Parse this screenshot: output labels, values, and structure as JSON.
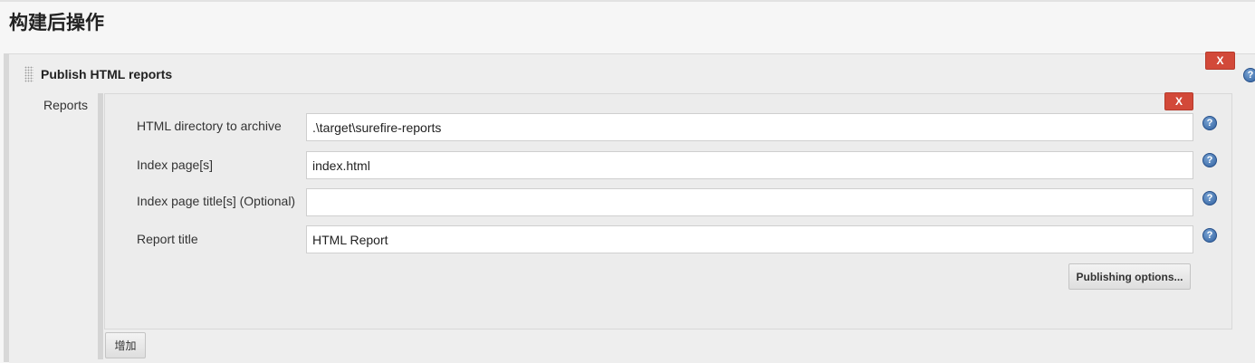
{
  "section_title": "构建后操作",
  "step": {
    "title": "Publish HTML reports",
    "delete_label": "X"
  },
  "reports": {
    "label": "Reports",
    "delete_label": "X",
    "fields": [
      {
        "label": "HTML directory to archive",
        "value": ".\\target\\surefire-reports"
      },
      {
        "label": "Index page[s]",
        "value": "index.html"
      },
      {
        "label": "Index page title[s] (Optional)",
        "value": ""
      },
      {
        "label": "Report title",
        "value": "HTML Report"
      }
    ],
    "publishing_options_label": "Publishing options..."
  },
  "add_button_label": "增加",
  "help_glyph": "?",
  "icons": {
    "help": "help-icon",
    "drag": "drag-handle-icon"
  },
  "colors": {
    "delete_button": "#d24939",
    "help_icon": "#2e5f9e"
  }
}
